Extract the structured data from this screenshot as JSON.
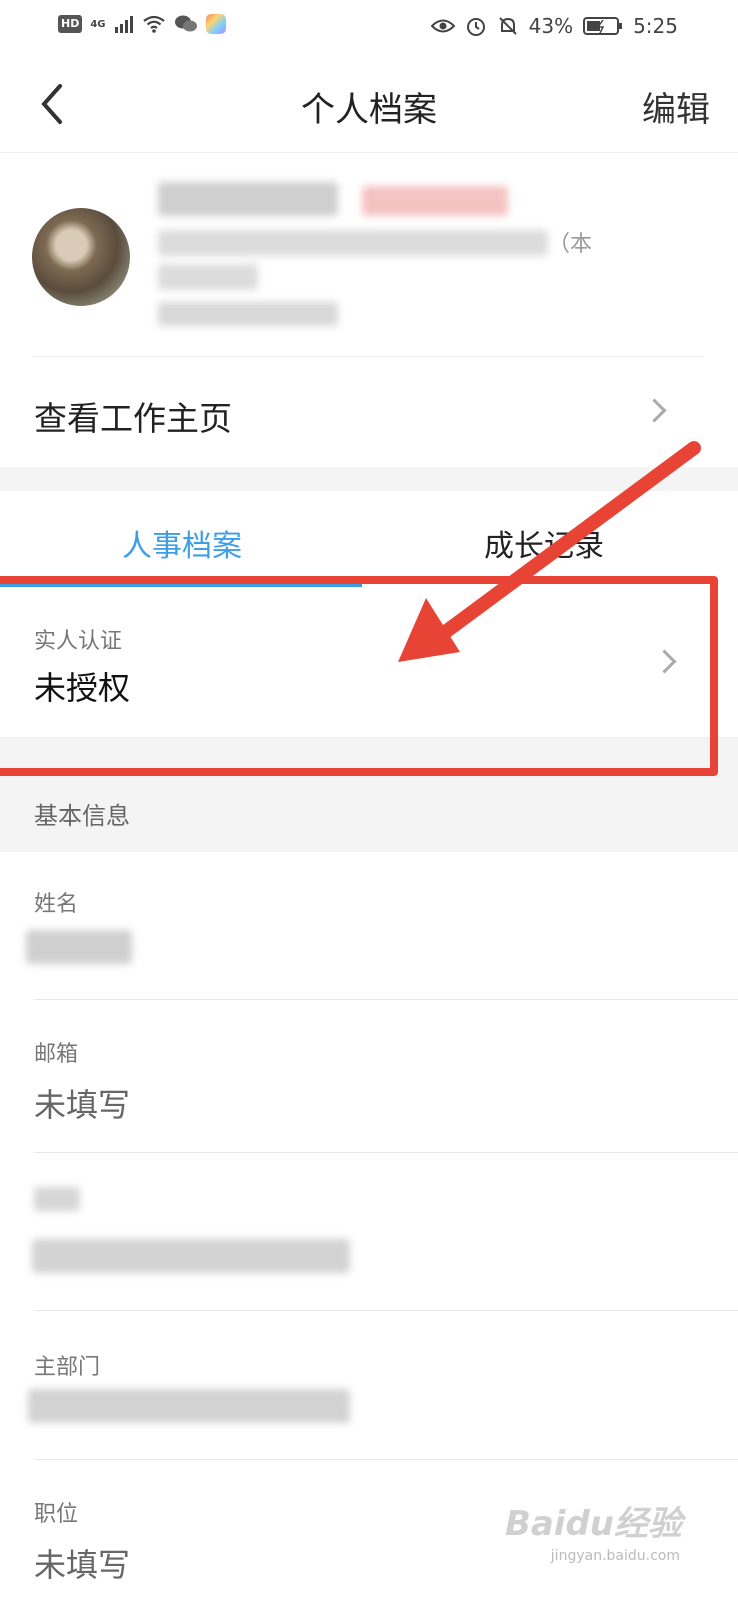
{
  "status_bar": {
    "hd": "HD",
    "network": "4G",
    "battery_pct": "43%",
    "time": "5:25"
  },
  "nav": {
    "title": "个人档案",
    "edit_label": "编辑"
  },
  "profile": {
    "work_homepage_label": "查看工作主页",
    "visible_fragment": "（本"
  },
  "tabs": [
    {
      "label": "人事档案",
      "active": true
    },
    {
      "label": "成长记录",
      "active": false
    }
  ],
  "real_person": {
    "label": "实人认证",
    "value": "未授权"
  },
  "basic_info": {
    "title": "基本信息",
    "fields": [
      {
        "label": "姓名",
        "value": ""
      },
      {
        "label": "邮箱",
        "value": "未填写"
      },
      {
        "label": "",
        "value": ""
      },
      {
        "label": "主部门",
        "value": ""
      },
      {
        "label": "职位",
        "value": "未填写"
      }
    ]
  },
  "watermark": {
    "brand": "Baidu经验",
    "url": "jingyan.baidu.com"
  },
  "colors": {
    "accent": "#3d9ee6",
    "highlight": "#e84436"
  }
}
